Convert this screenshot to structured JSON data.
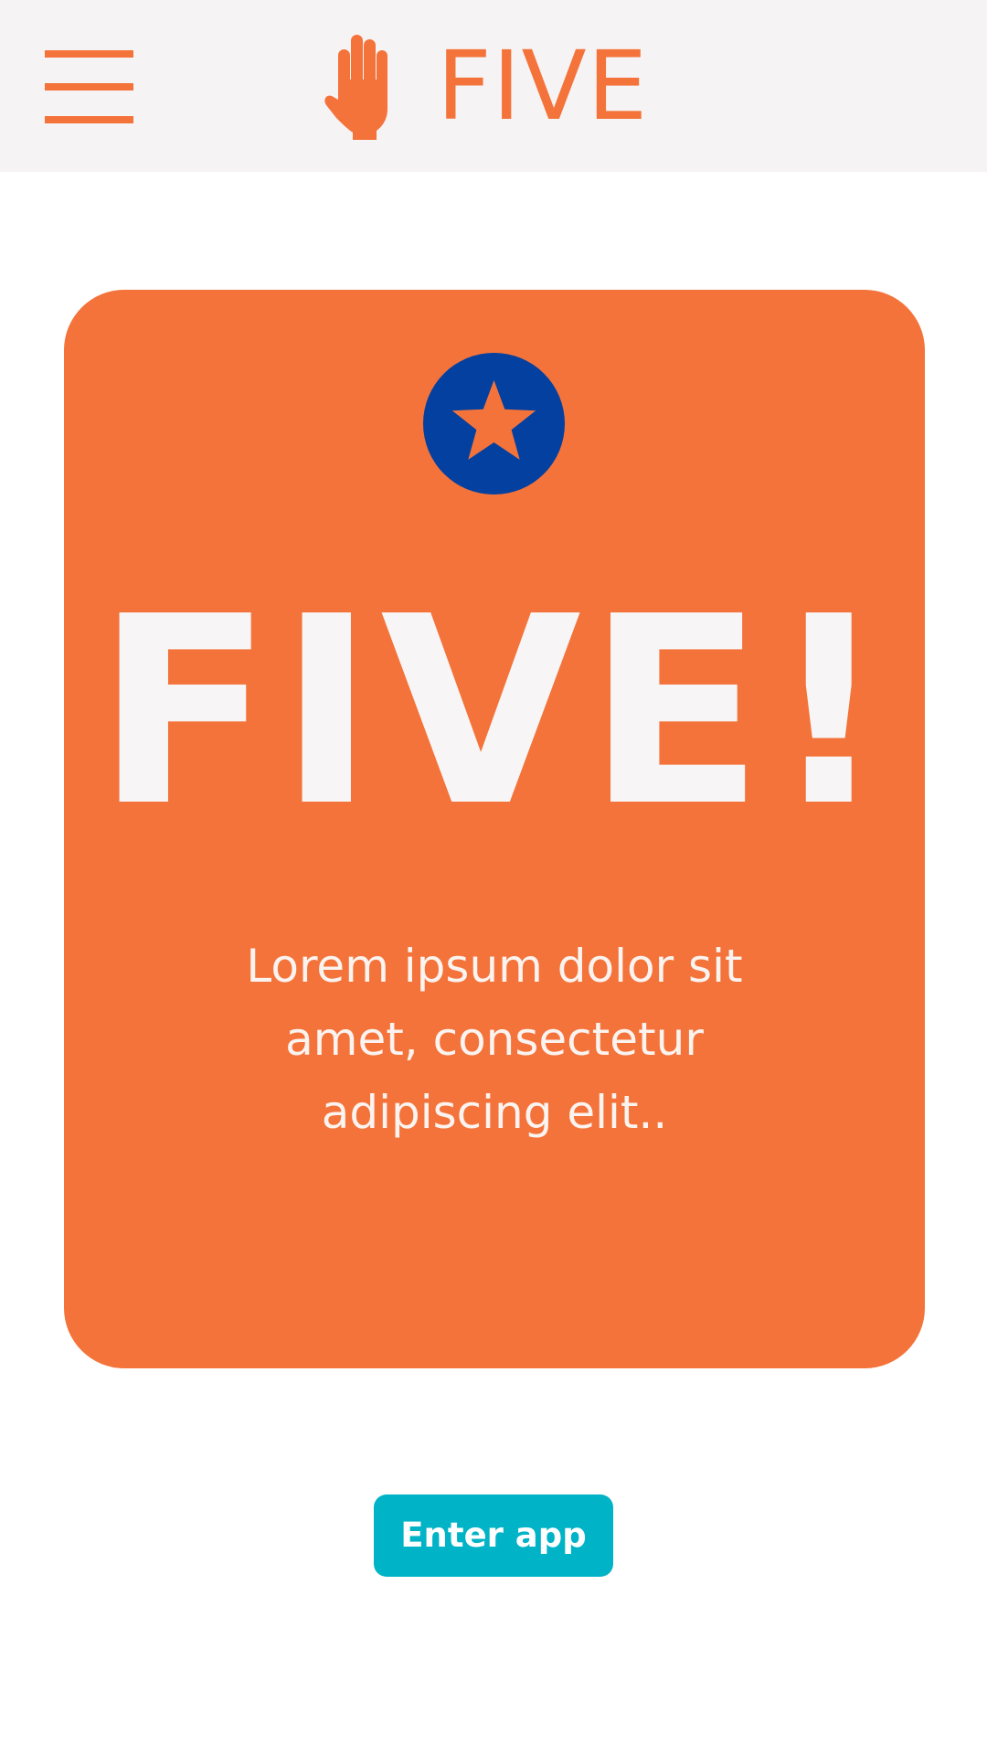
{
  "header": {
    "menu_icon": "hamburger-menu-icon",
    "logo_icon": "raised-hand-icon",
    "brand_name": "FIVE"
  },
  "card": {
    "badge_icon": "star-icon",
    "title": "FIVE!",
    "text": "Lorem ipsum dolor sit amet, consectetur adipiscing elit.."
  },
  "actions": {
    "enter_label": "Enter app"
  },
  "colors": {
    "accent_orange": "#f4733a",
    "header_bg": "#f6f3f4",
    "badge_blue": "#0340a0",
    "button_teal": "#00b3c6",
    "card_text": "#f7f5f5"
  }
}
